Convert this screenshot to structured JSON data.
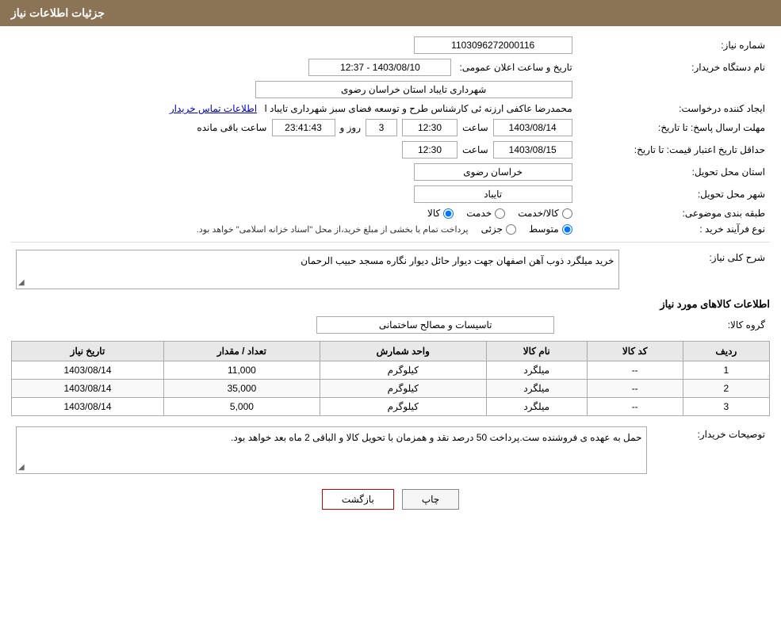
{
  "header": {
    "title": "جزئیات اطلاعات نیاز"
  },
  "fields": {
    "need_number_label": "شماره نیاز:",
    "need_number_value": "1103096272000116",
    "buyer_org_label": "نام دستگاه خریدار:",
    "buyer_org_value": "شهرداری تایباد استان خراسان رضوی",
    "date_label": "تاریخ و ساعت اعلان عمومی:",
    "date_value": "1403/08/10 - 12:37",
    "creator_label": "ایجاد کننده درخواست:",
    "creator_value": "محمدرضا عاکفی ارزنه ئی کارشناس طرح و توسعه فضای سبز شهرداری تایباد ا",
    "creator_link": "اطلاعات تماس خریدار",
    "deadline_label": "مهلت ارسال پاسخ: تا تاریخ:",
    "deadline_date": "1403/08/14",
    "deadline_time": "12:30",
    "deadline_days": "3",
    "deadline_counter": "23:41:43",
    "deadline_counter_label": "روز و",
    "deadline_remaining_label": "ساعت باقی مانده",
    "price_validity_label": "حداقل تاریخ اعتبار قیمت: تا تاریخ:",
    "price_validity_date": "1403/08/15",
    "price_validity_time": "12:30",
    "province_label": "استان محل تحویل:",
    "province_value": "خراسان رضوی",
    "city_label": "شهر محل تحویل:",
    "city_value": "تایباد",
    "category_label": "طبقه بندی موضوعی:",
    "category_goods": "کالا",
    "category_service": "خدمت",
    "category_goods_service": "کالا/خدمت",
    "category_selected": "کالا",
    "process_label": "نوع فرآیند خرید :",
    "process_partial": "جزئی",
    "process_medium": "متوسط",
    "process_note": "پرداخت تمام یا بخشی از مبلغ خرید،از محل \"اسناد خزانه اسلامی\" خواهد بود.",
    "description_label": "شرح کلی نیاز:",
    "description_value": "خرید میلگرد ذوب آهن اصفهان  جهت دیوار حائل دیوار نگاره مسجد حبیب الرحمان",
    "goods_info_title": "اطلاعات کالاهای مورد نیاز",
    "goods_group_label": "گروه کالا:",
    "goods_group_value": "تاسیسات و مصالح ساختمانی",
    "table": {
      "headers": [
        "ردیف",
        "کد کالا",
        "نام کالا",
        "واحد شمارش",
        "تعداد / مقدار",
        "تاریخ نیاز"
      ],
      "rows": [
        {
          "row": "1",
          "code": "--",
          "name": "میلگرد",
          "unit": "کیلوگرم",
          "qty": "11,000",
          "date": "1403/08/14"
        },
        {
          "row": "2",
          "code": "--",
          "name": "میلگرد",
          "unit": "کیلوگرم",
          "qty": "35,000",
          "date": "1403/08/14"
        },
        {
          "row": "3",
          "code": "--",
          "name": "میلگرد",
          "unit": "کیلوگرم",
          "qty": "5,000",
          "date": "1403/08/14"
        }
      ]
    },
    "buyer_notes_label": "توصیحات خریدار:",
    "buyer_notes_value": "حمل به عهده ی فروشنده ست.پرداخت 50 درصد نقد و همزمان با تحویل کالا و الباقی 2 ماه بعد خواهد بود.",
    "buttons": {
      "print": "چاپ",
      "back": "بازگشت"
    }
  }
}
